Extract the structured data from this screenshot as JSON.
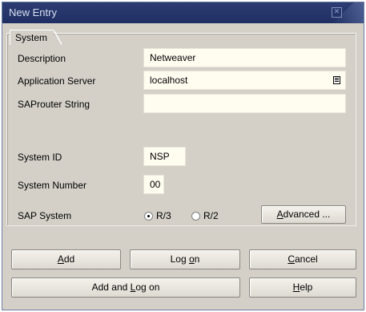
{
  "window": {
    "title": "New Entry"
  },
  "group": {
    "tab_label": "System"
  },
  "fields": {
    "description": {
      "label": "Description",
      "value": "Netweaver"
    },
    "app_server": {
      "label": "Application Server",
      "value": "localhost"
    },
    "saprouter": {
      "label": "SAProuter String",
      "value": ""
    },
    "system_id": {
      "label": "System ID",
      "value": "NSP"
    },
    "system_number": {
      "label": "System Number",
      "value": "00"
    }
  },
  "sap_system": {
    "label": "SAP System",
    "options": [
      "R/3",
      "R/2"
    ],
    "selected": "R/3"
  },
  "buttons": {
    "advanced": {
      "pre": "",
      "key": "A",
      "post": "dvanced ..."
    },
    "add": {
      "pre": "",
      "key": "A",
      "post": "dd"
    },
    "logon": {
      "pre": "Log ",
      "key": "o",
      "post": "n"
    },
    "cancel": {
      "pre": "",
      "key": "C",
      "post": "ancel"
    },
    "add_logon": {
      "pre": "Add and ",
      "key": "L",
      "post": "og on"
    },
    "help": {
      "pre": "",
      "key": "H",
      "post": "elp"
    }
  }
}
